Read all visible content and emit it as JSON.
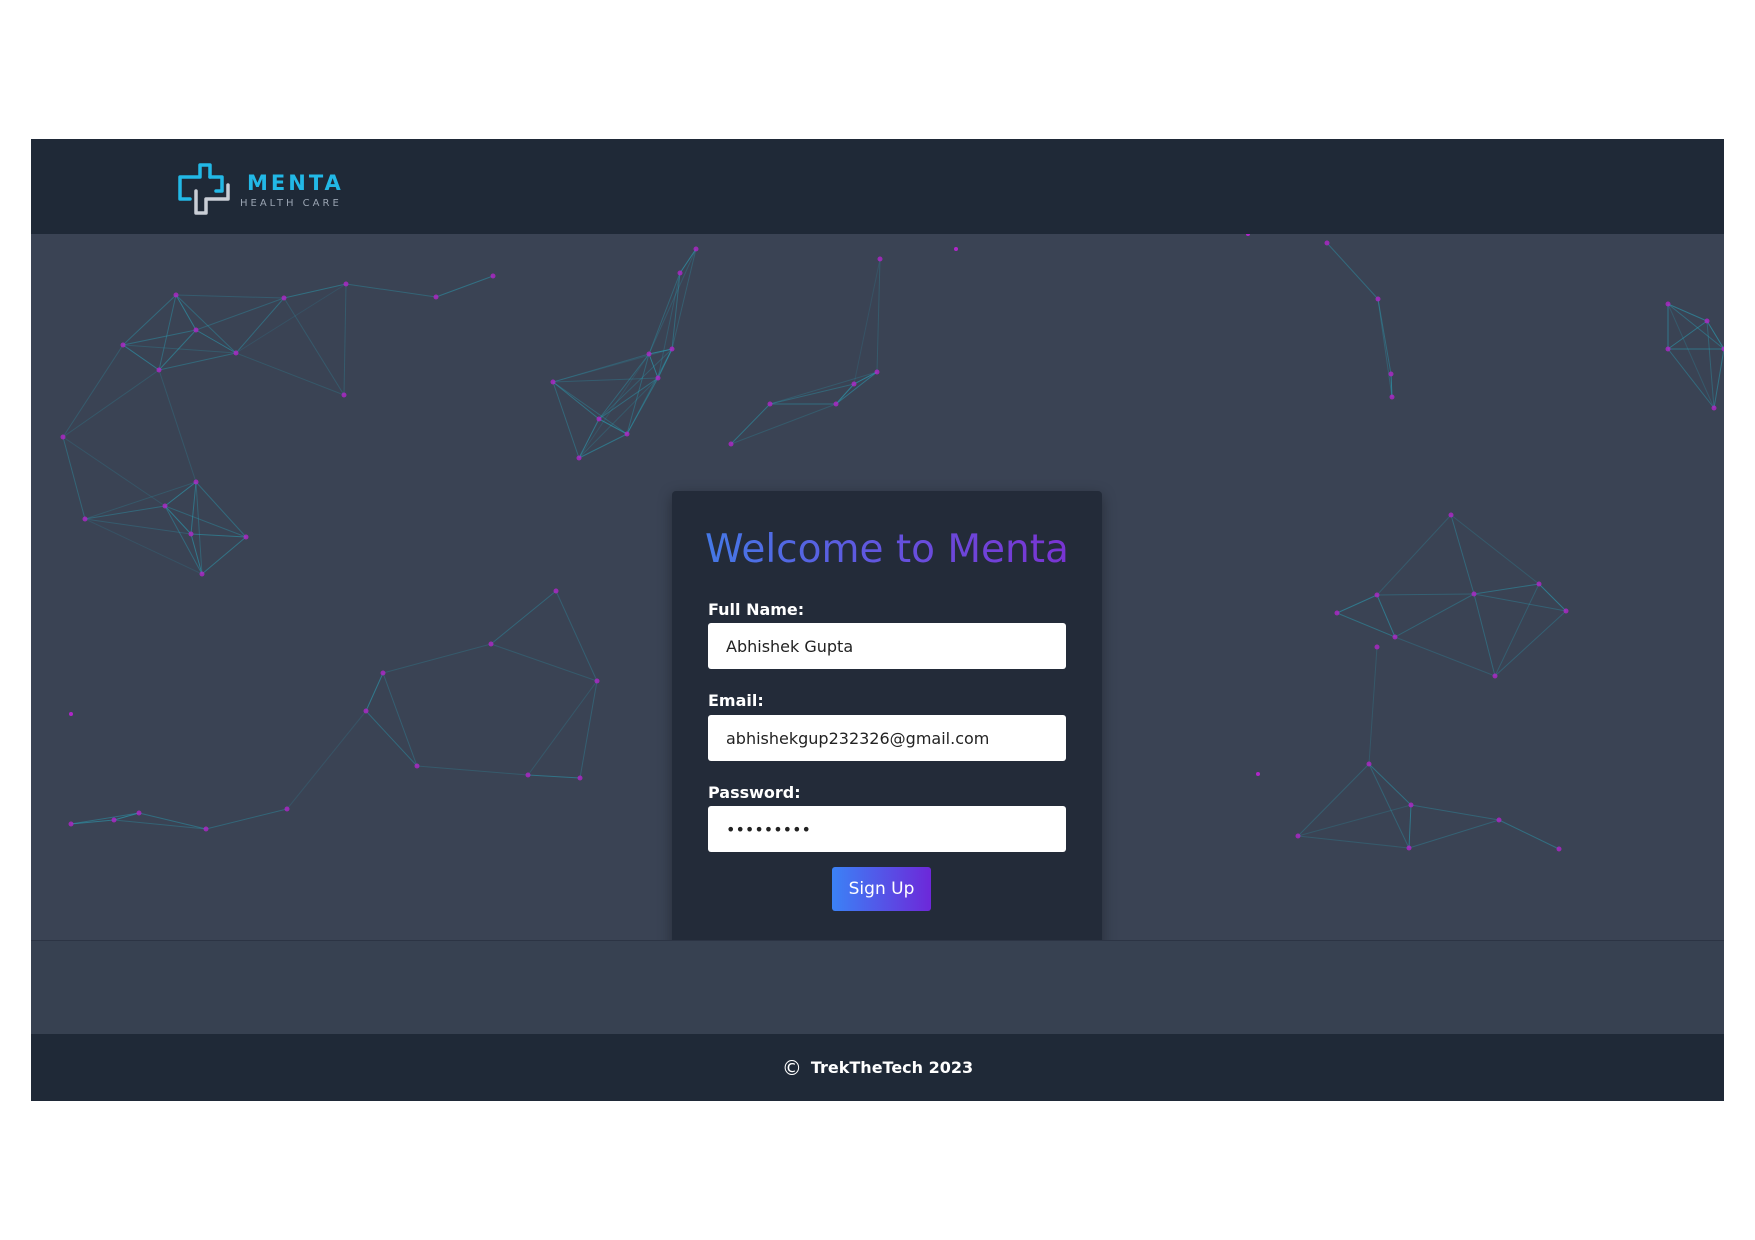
{
  "brand": {
    "name": "MENTA",
    "tagline": "HEALTH CARE",
    "primary_color": "#22b8e6",
    "logo_icon": "medical-cross-icon"
  },
  "signup_form": {
    "title": "Welcome to Menta",
    "full_name_label": "Full Name:",
    "full_name_value": "Abhishek Gupta",
    "email_label": "Email:",
    "email_value": "abhishekgup232326@gmail.com",
    "password_label": "Password:",
    "password_value": "•••••••••",
    "submit_label": "Sign Up",
    "title_gradient": [
      "#3f7fe8",
      "#7d2ed0"
    ],
    "button_gradient": [
      "#3b82f6",
      "#6d28d9"
    ]
  },
  "footer": {
    "copyright_symbol": "©",
    "text": "TrekTheTech 2023"
  },
  "theme": {
    "header_bg": "#1f2937",
    "hero_bg": "#3a4354",
    "card_bg": "#232b39",
    "network_line": "#2aa3b8",
    "network_node": "#b026c9"
  }
}
